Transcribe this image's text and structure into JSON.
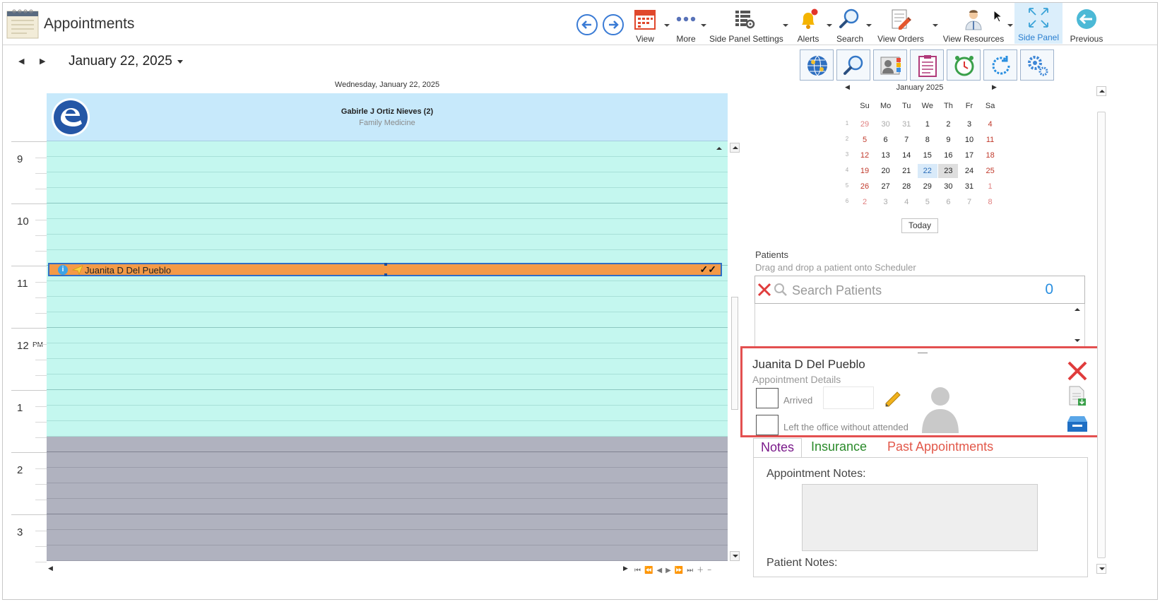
{
  "app": {
    "title": "Appointments",
    "icon": "calendar-notepad-icon"
  },
  "toolbar": {
    "back_icon": "arrow-left-circle-icon",
    "forward_icon": "arrow-right-circle-icon",
    "buttons": [
      {
        "label": "View",
        "icon": "calendar-icon",
        "has_dropdown": true
      },
      {
        "label": "More",
        "icon": "more-dots-icon",
        "has_dropdown": true
      },
      {
        "label": "Side Panel Settings",
        "icon": "grid-settings-icon",
        "has_dropdown": true
      },
      {
        "label": "Alerts",
        "icon": "bell-icon",
        "has_dropdown": true
      },
      {
        "label": "Search",
        "icon": "magnifier-icon",
        "has_dropdown": true
      },
      {
        "label": "View Orders",
        "icon": "orders-pencil-icon",
        "has_dropdown": true
      },
      {
        "label": "View Resources",
        "icon": "doctor-icon",
        "has_dropdown": true
      },
      {
        "label": "Side Panel",
        "icon": "expand-arrows-icon",
        "active": true
      },
      {
        "label": "Previous",
        "icon": "back-circle-icon"
      }
    ]
  },
  "scheduler": {
    "date_title": "January 22, 2025",
    "day_header": "Wednesday, January 22, 2025",
    "resource": {
      "name": "Gabirle J Ortiz Nieves (2)",
      "specialty": "Family Medicine",
      "logo": "e-logo-icon"
    },
    "hours": [
      {
        "label": "9",
        "ampm": ""
      },
      {
        "label": "10",
        "ampm": ""
      },
      {
        "label": "11",
        "ampm": ""
      },
      {
        "label": "12",
        "ampm": "PM"
      },
      {
        "label": "1",
        "ampm": ""
      },
      {
        "label": "2",
        "ampm": ""
      },
      {
        "label": "3",
        "ampm": ""
      }
    ],
    "appointment": {
      "patient": "Juanita D Del Pueblo",
      "status_checks": "✓✓"
    }
  },
  "side_panel": {
    "tools": [
      "globe-icon",
      "magnifier-icon",
      "contact-card-icon",
      "clipboard-list-icon",
      "alarm-clock-icon",
      "refresh-icon",
      "gears-icon"
    ],
    "mini_calendar": {
      "title": "January 2025",
      "weekdays": [
        "Su",
        "Mo",
        "Tu",
        "We",
        "Th",
        "Fr",
        "Sa"
      ],
      "weeks": [
        {
          "num": "1",
          "days": [
            "29",
            "30",
            "31",
            "1",
            "2",
            "3",
            "4"
          ]
        },
        {
          "num": "2",
          "days": [
            "5",
            "6",
            "7",
            "8",
            "9",
            "10",
            "11"
          ]
        },
        {
          "num": "3",
          "days": [
            "12",
            "13",
            "14",
            "15",
            "16",
            "17",
            "18"
          ]
        },
        {
          "num": "4",
          "days": [
            "19",
            "20",
            "21",
            "22",
            "23",
            "24",
            "25"
          ]
        },
        {
          "num": "5",
          "days": [
            "26",
            "27",
            "28",
            "29",
            "30",
            "31",
            "1"
          ]
        },
        {
          "num": "6",
          "days": [
            "2",
            "3",
            "4",
            "5",
            "6",
            "7",
            "8"
          ]
        }
      ],
      "selected": "22",
      "today": "23",
      "today_button": "Today"
    },
    "patients": {
      "label": "Patients",
      "hint": "Drag and drop a patient onto Scheduler",
      "search_placeholder": "Search Patients",
      "count": "0"
    },
    "details": {
      "patient_name": "Juanita D Del Pueblo",
      "subtitle": "Appointment Details",
      "arrived_label": "Arrived",
      "left_label": "Left the office without attended"
    },
    "tabs": {
      "notes": "Notes",
      "insurance": "Insurance",
      "past": "Past Appointments"
    },
    "appointment_notes_label": "Appointment Notes:",
    "patient_notes_label": "Patient Notes:"
  },
  "colors": {
    "slot": "#c4f7ef",
    "off_hours": "#b0b2bf",
    "resource_header": "#c7e9fb",
    "appointment": "#f49a47",
    "highlight_border": "#e35050",
    "accent": "#2a7fd0"
  }
}
